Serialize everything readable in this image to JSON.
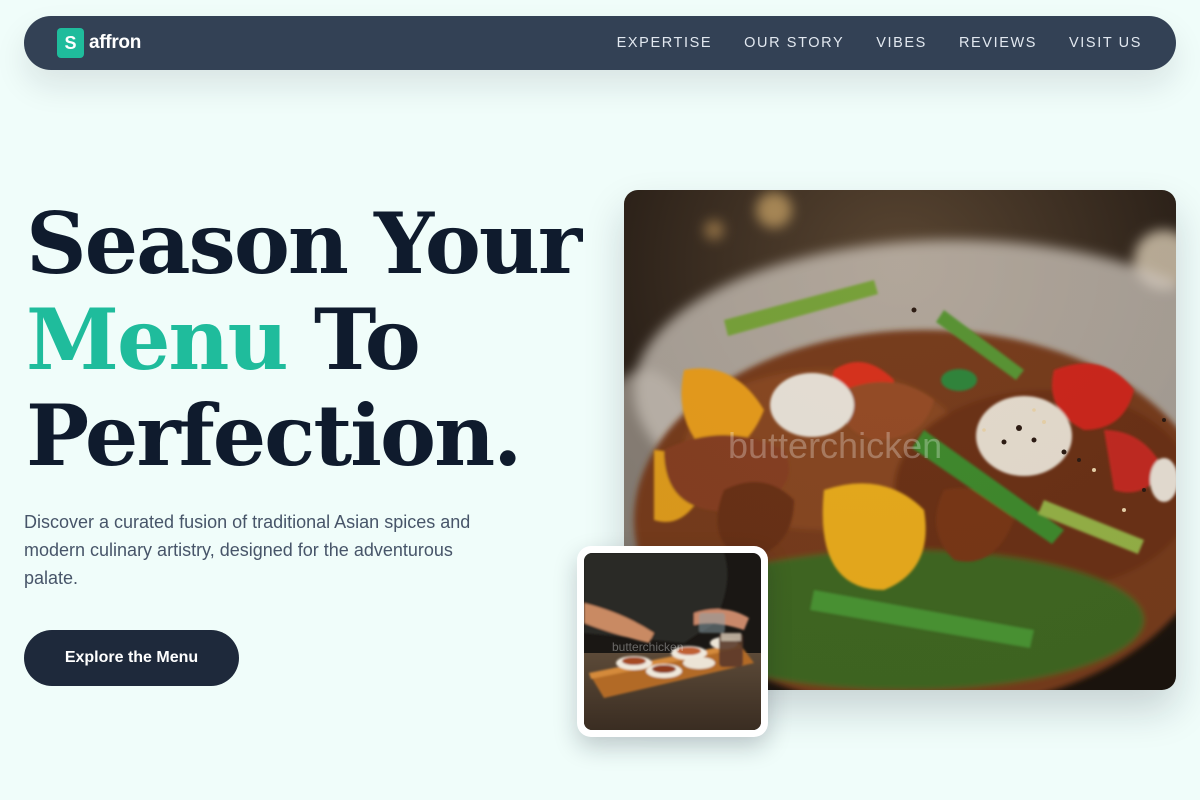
{
  "brand": {
    "mark": "S",
    "name": "affron"
  },
  "nav": {
    "links": [
      "EXPERTISE",
      "OUR STORY",
      "VIBES",
      "REVIEWS",
      "VISIT US"
    ]
  },
  "hero": {
    "headline_line1": "Season Your",
    "headline_accent": "Menu",
    "headline_line2_rest": " To",
    "headline_line3": "Perfection.",
    "description": "Discover a curated fusion of traditional Asian spices and modern culinary artistry, designed for the adventurous palate.",
    "cta_label": "Explore the Menu"
  },
  "images": {
    "main_watermark": "butterchicken",
    "inset_watermark": "butterchicken"
  },
  "colors": {
    "background": "#f0fdfa",
    "nav": "#334155",
    "accent": "#1fbc9c",
    "heading": "#0f1b2d",
    "cta": "#1e293b"
  }
}
